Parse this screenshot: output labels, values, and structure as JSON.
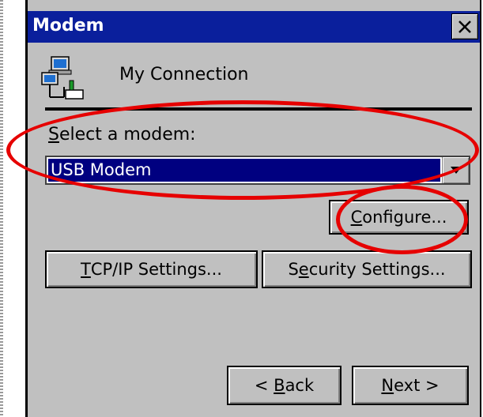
{
  "window": {
    "title": "Modem",
    "close_glyph": "✕"
  },
  "connection": {
    "name": "My Connection",
    "icon": "network-connection-icon"
  },
  "modem_select": {
    "label_first": "S",
    "label_rest": "elect a modem:",
    "value": "USB Modem",
    "arrow_icon": "chevron-down-icon"
  },
  "buttons": {
    "configure": {
      "mnemonic": "C",
      "rest": "onfigure..."
    },
    "tcpip": {
      "mnemonic": "T",
      "rest": "CP/IP Settings..."
    },
    "security": {
      "pre": "S",
      "mnemonic": "e",
      "rest": "curity Settings..."
    },
    "back": {
      "pre": "< ",
      "mnemonic": "B",
      "rest": "ack"
    },
    "next": {
      "mnemonic": "N",
      "rest": "ext >"
    }
  },
  "colors": {
    "titlebar": "#0a1f9c",
    "selection": "#000080",
    "annotation": "#e60000",
    "face": "#c0c0c0"
  }
}
